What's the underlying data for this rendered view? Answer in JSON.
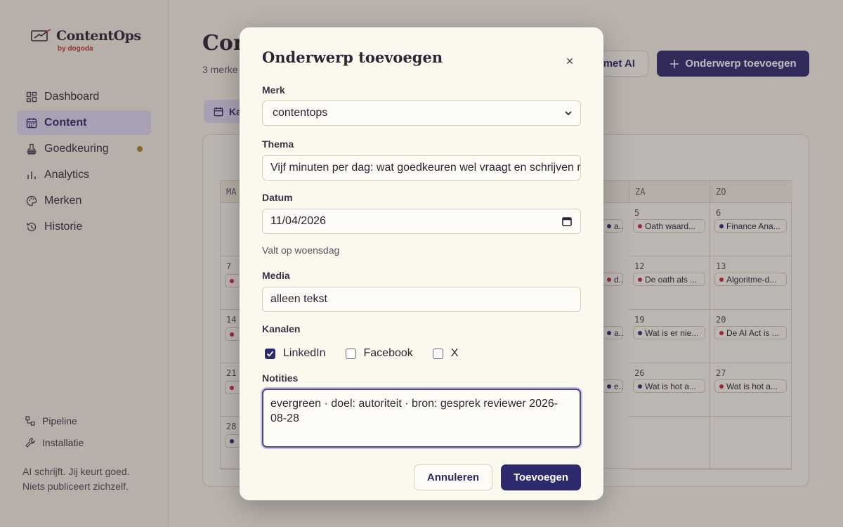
{
  "app": {
    "name": "ContentOps",
    "sub": "by dogoda"
  },
  "sidebar": {
    "items": [
      {
        "label": "Dashboard",
        "icon": "grid-icon"
      },
      {
        "label": "Content",
        "icon": "calendar-icon",
        "active": true
      },
      {
        "label": "Goedkeuring",
        "icon": "stamp-icon",
        "has_dot": true
      },
      {
        "label": "Analytics",
        "icon": "bar-chart-icon"
      },
      {
        "label": "Merken",
        "icon": "palette-icon"
      },
      {
        "label": "Historie",
        "icon": "history-icon"
      }
    ],
    "footer_items": [
      {
        "label": "Pipeline",
        "icon": "pipeline-icon"
      },
      {
        "label": "Installatie",
        "icon": "wrench-icon"
      }
    ],
    "tagline_1": "AI schrijft. Jij keurt goed.",
    "tagline_2": "Niets publiceert zichzelf."
  },
  "header": {
    "title_visible": "Con",
    "subtitle_visible": "3 merke",
    "ai_button_visible": "met AI",
    "add_button": "Onderwerp toevoegen",
    "view_tab_visible": "Ka"
  },
  "calendar": {
    "weekday_left": "MA",
    "weekday_za": "ZA",
    "weekday_zo": "ZO",
    "left_days": [
      "7",
      "14",
      "21",
      "28"
    ],
    "za_days": [
      "5",
      "12",
      "19",
      "26"
    ],
    "zo_days": [
      "6",
      "13",
      "20",
      "27"
    ],
    "mid_chips": [
      "a...",
      "d...",
      "a...",
      "e..."
    ],
    "za_chips": [
      "Oath waard...",
      "De oath als ...",
      "Wat is er nie...",
      "Wat is hot a..."
    ],
    "zo_chips": [
      "Finance Ana...",
      "Algoritme-d...",
      "De AI Act is ...",
      "Wat is hot a..."
    ],
    "left_chip_dots": [
      "#c8283a",
      "#c8283a",
      "#c8283a",
      "#2f2a6e"
    ],
    "mid_chip_dots": [
      "#2f2a6e",
      "#c8283a",
      "#2f2a6e",
      "#2f2a6e"
    ],
    "za_chip_dots": [
      "#c8283a",
      "#c8283a",
      "#2f2a6e",
      "#2f2a6e"
    ],
    "zo_chip_dots": [
      "#2f2a6e",
      "#c8283a",
      "#c8283a",
      "#c8283a"
    ]
  },
  "modal": {
    "title": "Onderwerp toevoegen",
    "close_label": "×",
    "merk_label": "Merk",
    "merk_value": "contentops",
    "thema_label": "Thema",
    "thema_value": "Vijf minuten per dag: wat goedkeuren wel vraagt en schrijven r",
    "datum_label": "Datum",
    "datum_value": "11/04/2026",
    "datum_helper": "Valt op woensdag",
    "media_label": "Media",
    "media_value": "alleen tekst",
    "kanalen_label": "Kanalen",
    "kanalen": [
      {
        "label": "LinkedIn",
        "checked": true
      },
      {
        "label": "Facebook",
        "checked": false
      },
      {
        "label": "X",
        "checked": false
      }
    ],
    "notities_label": "Notities",
    "notities_value": "evergreen · doel: autoriteit · bron: gesprek reviewer 2026-08-28",
    "cancel_label": "Annuleren",
    "submit_label": "Toevoegen"
  },
  "colors": {
    "accent": "#2f2a6e",
    "accent_soft": "#ded9f0",
    "status_dot": "#a8812c",
    "red_dot": "#c8283a"
  }
}
